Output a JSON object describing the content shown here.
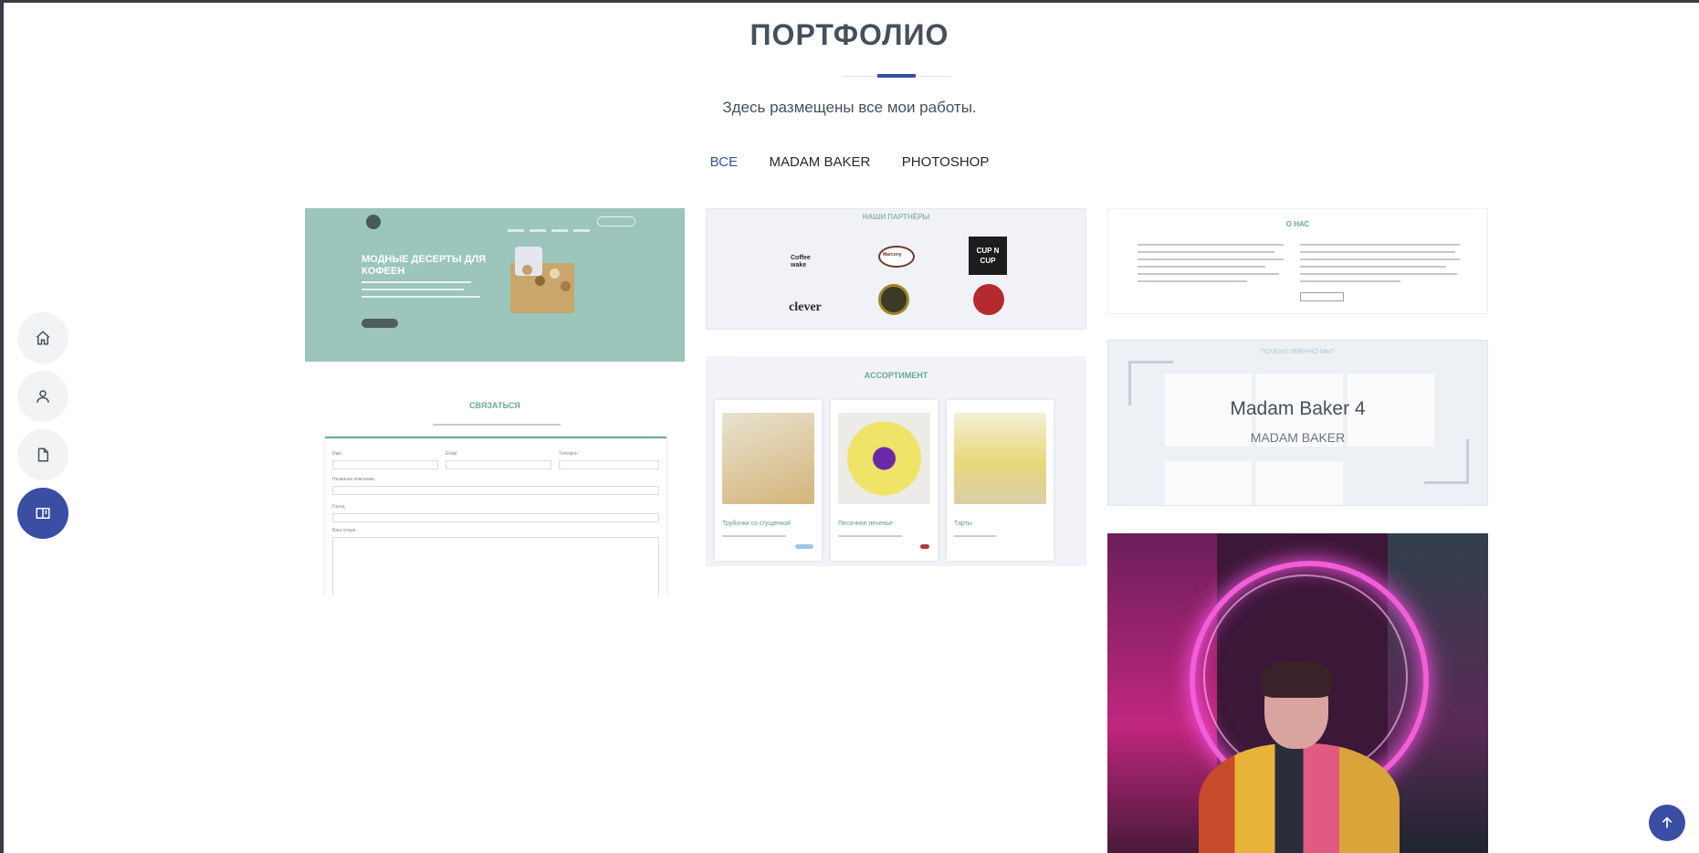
{
  "section": {
    "title": "ПОРТФОЛИО",
    "subtitle": "Здесь размещены все мои работы."
  },
  "filters": [
    {
      "label": "Все",
      "active": true
    },
    {
      "label": "Madam Baker",
      "active": false
    },
    {
      "label": "Photoshop",
      "active": false
    }
  ],
  "sidenav": {
    "items": [
      {
        "icon": "home-icon"
      },
      {
        "icon": "user-icon"
      },
      {
        "icon": "file-icon"
      },
      {
        "icon": "book-icon",
        "active": true
      }
    ]
  },
  "portfolio": {
    "hover_item": {
      "title": "Madam Baker 4",
      "category": "MADAM BAKER"
    },
    "tile1": {
      "heading": "МОДНЫЕ ДЕСЕРТЫ ДЛЯ КОФЕЕН"
    },
    "tile2": {
      "heading": "СВЯЗАТЬСЯ",
      "fields": [
        "Имя",
        "Email",
        "Телефон",
        "Название компании",
        "Город",
        "Ваш отзыв"
      ]
    },
    "tile3": {
      "heading": "НАШИ ПАРТНЁРЫ",
      "partners": [
        "Coffee wake",
        "Marcony",
        "CUP N CUP",
        "clever"
      ]
    },
    "tile4": {
      "heading": "АССОРТИМЕНТ",
      "items": [
        "Трубочки со сгущенкой",
        "Песочное печенье",
        "Тарты"
      ]
    },
    "tile5": {
      "heading": "О НАС"
    },
    "tile6": {
      "heading": "ПОЧЕМУ ИМЕННО МЫ?"
    }
  },
  "colors": {
    "accent": "#3a4ea3",
    "text": "#45505b",
    "mint": "#9cc5bb"
  }
}
